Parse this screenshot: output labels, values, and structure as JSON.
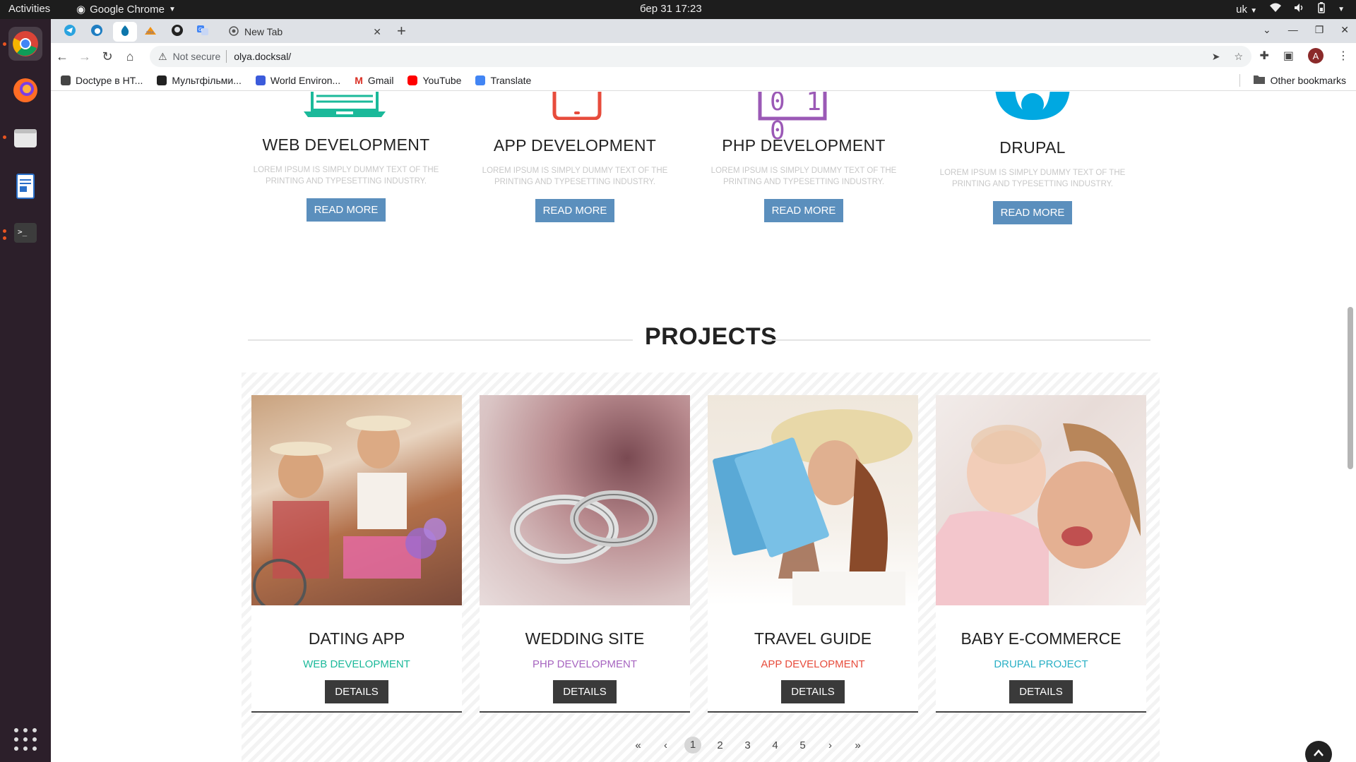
{
  "os": {
    "activities": "Activities",
    "app_menu": "Google Chrome",
    "clock": "бер 31  17:23",
    "keyboard_layout": "uk"
  },
  "browser": {
    "tab_title": "New Tab",
    "url_warning": "Not secure",
    "url": "olya.docksal/",
    "bookmarks": [
      {
        "label": "Doctype в НТ...",
        "color": "#444444"
      },
      {
        "label": "Мультфільми...",
        "color": "#222222"
      },
      {
        "label": "World Environ...",
        "color": "#3b5bdb"
      },
      {
        "label": "Gmail",
        "color": "#d93025"
      },
      {
        "label": "YouTube",
        "color": "#ff0000"
      },
      {
        "label": "Translate",
        "color": "#4285f4"
      }
    ],
    "other_bookmarks": "Other bookmarks",
    "avatar_letter": "A"
  },
  "services": [
    {
      "title": "WEB DEVELOPMENT",
      "desc": "LOREM IPSUM IS SIMPLY DUMMY TEXT OF THE PRINTING AND TYPESETTING INDUSTRY.",
      "button": "READ MORE",
      "icon_color": "#1bb99a"
    },
    {
      "title": "APP DEVELOPMENT",
      "desc": "LOREM IPSUM IS SIMPLY DUMMY TEXT OF THE PRINTING AND TYPESETTING INDUSTRY.",
      "button": "READ MORE",
      "icon_color": "#e74c3c"
    },
    {
      "title": "PHP DEVELOPMENT",
      "desc": "LOREM IPSUM IS SIMPLY DUMMY TEXT OF THE PRINTING AND TYPESETTING INDUSTRY.",
      "button": "READ MORE",
      "icon_color": "#9b59b6",
      "icon_text": "0 1 0"
    },
    {
      "title": "DRUPAL",
      "desc": "LOREM IPSUM IS SIMPLY DUMMY TEXT OF THE PRINTING AND TYPESETTING INDUSTRY.",
      "button": "READ MORE",
      "icon_color": "#00a8e1"
    }
  ],
  "projects": {
    "heading": "PROJECTS",
    "items": [
      {
        "title": "DATING APP",
        "category": "WEB DEVELOPMENT",
        "category_color": "#1bb99a",
        "button": "DETAILS"
      },
      {
        "title": "WEDDING SITE",
        "category": "PHP DEVELOPMENT",
        "category_color": "#a765c0",
        "button": "DETAILS"
      },
      {
        "title": "TRAVEL GUIDE",
        "category": "APP DEVELOPMENT",
        "category_color": "#e74c3c",
        "button": "DETAILS"
      },
      {
        "title": "BABY E-COMMERCE",
        "category": "DRUPAL PROJECT",
        "category_color": "#2ab0c5",
        "button": "DETAILS"
      }
    ]
  },
  "pagination": {
    "first": "«",
    "prev": "‹",
    "pages": [
      "1",
      "2",
      "3",
      "4",
      "5"
    ],
    "next": "›",
    "last": "»"
  }
}
